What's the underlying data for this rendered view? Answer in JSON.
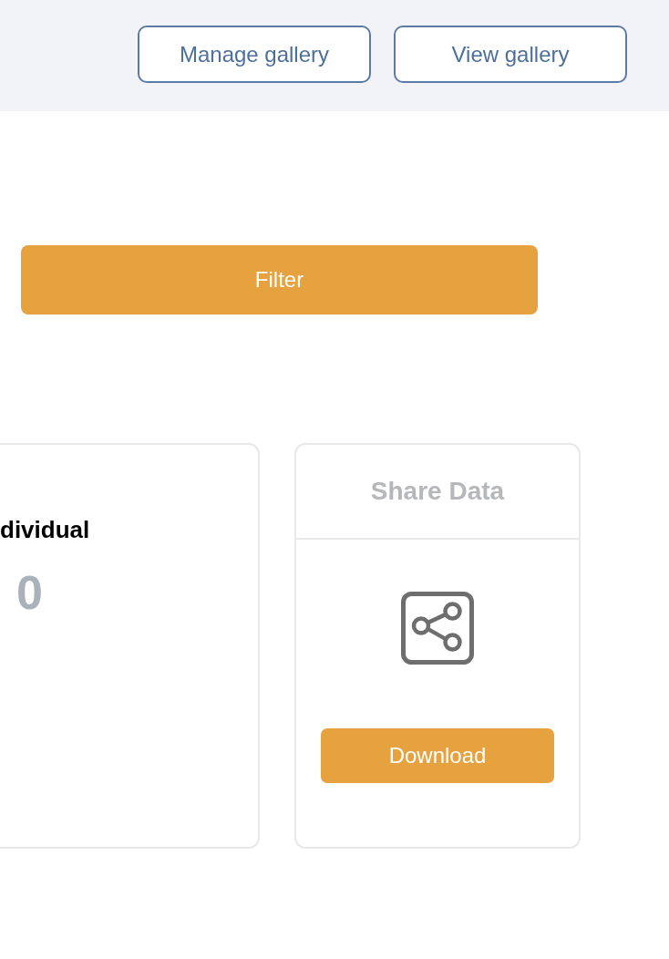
{
  "header": {
    "buttons": [
      {
        "label": "Manage gallery"
      },
      {
        "label": "View gallery"
      }
    ]
  },
  "filter": {
    "button": "Filter"
  },
  "cards": [
    {
      "kind": "stat",
      "title": "dividual",
      "value": "0"
    },
    {
      "kind": "action",
      "title": "Share Data",
      "button": "Download"
    }
  ]
}
